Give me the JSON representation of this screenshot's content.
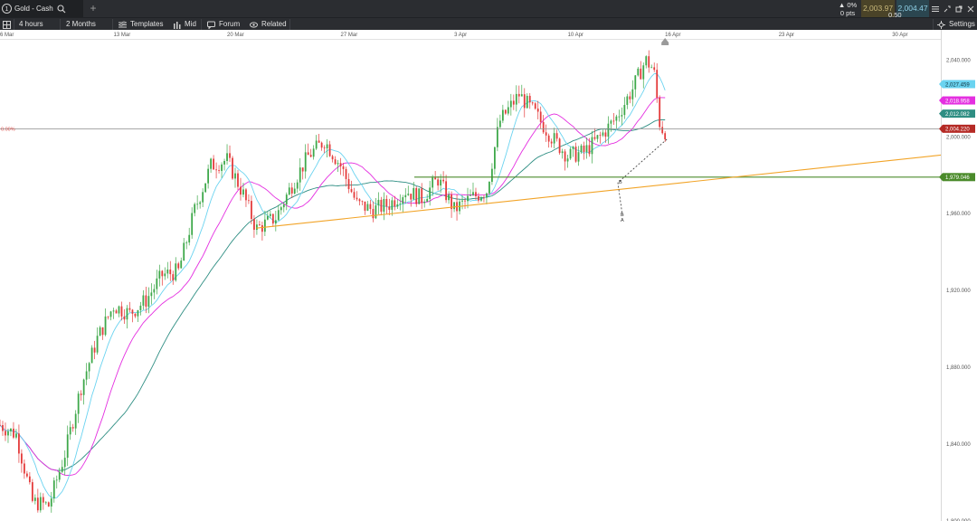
{
  "window": {
    "tab_number": "1",
    "tab_title": "Gold - Cash",
    "add_tab": "+"
  },
  "quote": {
    "change_pct": "▲ 0%",
    "change_pts": "0 pts",
    "sell_price": "2,003.97",
    "buy_price": "2,004.47",
    "spread": "0.50"
  },
  "toolbar": {
    "interval": "4 hours",
    "range": "2 Months",
    "templates": "Templates",
    "price_type": "Mid",
    "forum": "Forum",
    "related": "Related",
    "settings": "Settings"
  },
  "chart_data": {
    "type": "candlestick",
    "instrument": "Gold - Cash",
    "x_labels": [
      "6 Mar",
      "13 Mar",
      "20 Mar",
      "27 Mar",
      "3 Apr",
      "10 Apr",
      "16 Apr",
      "23 Apr",
      "30 Apr"
    ],
    "x_label_days": [
      6,
      13,
      20,
      27,
      34,
      41,
      47,
      54,
      61
    ],
    "x_range_days": [
      6,
      64
    ],
    "y_ticks": [
      1800,
      1840,
      1880,
      1920,
      1960,
      2000,
      2040
    ],
    "y_tick_labels": [
      "1,800.000",
      "1,840.000",
      "1,880.000",
      "1,920.000",
      "1,960.000",
      "2,000.000",
      "2,040.000"
    ],
    "y_range": [
      1800,
      2051
    ],
    "current_price": 2004.22,
    "current_price_label": "2,004.220",
    "price_badges": [
      {
        "value": 2027.459,
        "label": "2,027.459",
        "color": "#6ad3f0"
      },
      {
        "value": 2018.958,
        "label": "2,018.958",
        "color": "#e42fe0"
      },
      {
        "value": 2012.082,
        "label": "2,012.082",
        "color": "#2e8e83"
      }
    ],
    "horizontal_level": {
      "value": 1979.046,
      "label": "1,979.046",
      "color": "#4b8b2b"
    },
    "left_level_label": "0.00%",
    "trendline": {
      "points": [
        [
          21.8,
          1952.5
        ],
        [
          64,
          1990.5
        ]
      ],
      "color": "#f2a428"
    },
    "projection_labels": [
      "B",
      "B",
      "A"
    ],
    "up_color": "#3ea84a",
    "down_color": "#e43b3b",
    "ma_colors": {
      "cyan": "#6ad3f0",
      "magenta": "#e42fe0",
      "teal": "#2e8e83"
    },
    "candles_close_anchor": [
      [
        6,
        1850
      ],
      [
        7,
        1845
      ],
      [
        8,
        1810
      ],
      [
        9,
        1808
      ],
      [
        10,
        1835
      ],
      [
        11,
        1870
      ],
      [
        12,
        1895
      ],
      [
        13,
        1912
      ],
      [
        14,
        1908
      ],
      [
        15,
        1915
      ],
      [
        16,
        1928
      ],
      [
        17,
        1930
      ],
      [
        18,
        1962
      ],
      [
        19,
        1985
      ],
      [
        20,
        1988
      ],
      [
        21,
        1970
      ],
      [
        21.8,
        1952
      ],
      [
        23,
        1958
      ],
      [
        24,
        1975
      ],
      [
        25,
        1990
      ],
      [
        26,
        1998
      ],
      [
        27,
        1985
      ],
      [
        28,
        1965
      ],
      [
        29,
        1962
      ],
      [
        30,
        1965
      ],
      [
        31,
        1972
      ],
      [
        32,
        1968
      ],
      [
        33,
        1978
      ],
      [
        34,
        1962
      ],
      [
        35,
        1968
      ],
      [
        36,
        1972
      ],
      [
        36.8,
        2008
      ],
      [
        38,
        2022
      ],
      [
        39,
        2012
      ],
      [
        40,
        2000
      ],
      [
        41,
        1990
      ],
      [
        42,
        1992
      ],
      [
        43,
        2000
      ],
      [
        44,
        2010
      ],
      [
        45,
        2025
      ],
      [
        45.8,
        2040
      ],
      [
        46.3,
        2035
      ],
      [
        46.7,
        2005
      ],
      [
        47,
        2003
      ]
    ]
  }
}
